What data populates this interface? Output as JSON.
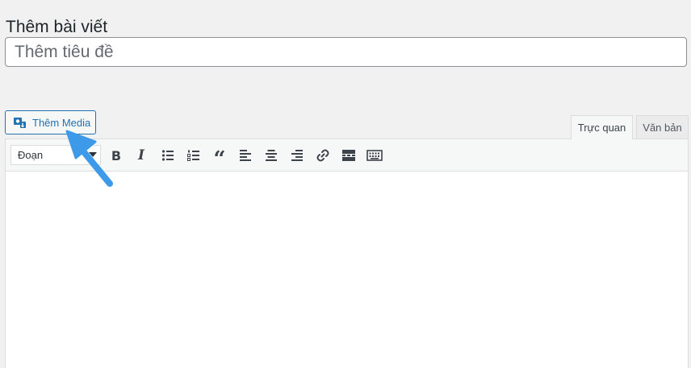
{
  "page": {
    "title": "Thêm bài viết"
  },
  "post_title": {
    "placeholder": "Thêm tiêu đề",
    "value": ""
  },
  "media_button": {
    "label": "Thêm Media",
    "icon": "add-media-icon"
  },
  "tabs": [
    {
      "label": "Trực quan",
      "active": true
    },
    {
      "label": "Văn bản",
      "active": false
    }
  ],
  "toolbar": {
    "format_select": "Đoạn",
    "buttons": [
      {
        "name": "bold",
        "glyph": "B"
      },
      {
        "name": "italic",
        "glyph": "I"
      },
      {
        "name": "bulleted-list",
        "glyph": ""
      },
      {
        "name": "numbered-list",
        "glyph": ""
      },
      {
        "name": "blockquote",
        "glyph": "“"
      },
      {
        "name": "align-left",
        "glyph": ""
      },
      {
        "name": "align-center",
        "glyph": ""
      },
      {
        "name": "align-right",
        "glyph": ""
      },
      {
        "name": "insert-link",
        "glyph": ""
      },
      {
        "name": "read-more",
        "glyph": ""
      },
      {
        "name": "toolbar-toggle",
        "glyph": ""
      }
    ]
  },
  "annotation": {
    "arrow_color": "#3d9ae8",
    "arrow_icon": "pointer-arrow-icon"
  },
  "colors": {
    "accent": "#2271b1",
    "background": "#f1f1f1"
  }
}
